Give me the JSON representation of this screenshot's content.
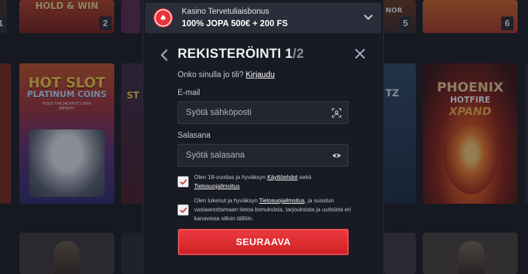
{
  "background_games": {
    "top_row": [
      {
        "name": "HOLD & WIN",
        "rank": "1"
      },
      {
        "name": "",
        "rank": "2"
      },
      {
        "name": "",
        "rank": ""
      },
      {
        "name": "NOR",
        "rank": "5"
      },
      {
        "name": "",
        "rank": "6"
      }
    ],
    "middle_row": [
      {
        "name": "HOT SLOT",
        "subtitle": "PLATINUM COINS",
        "tagline": "HOLD THE JACKPOT CASH INFINITY"
      },
      {
        "name": "ST"
      },
      {
        "name": "TZ"
      },
      {
        "name": "PHOENIX",
        "subtitle": "HOTFIRE",
        "tagline": "XPAND"
      }
    ]
  },
  "bonus_banner": {
    "chip_symbol": "♠",
    "title": "Kasino Tervetuliaisbonus",
    "offer": "100% JOPA 500€ + 200 FS",
    "expand_icon": "chevron-down-icon"
  },
  "form": {
    "back_icon": "chevron-left-icon",
    "title": "REKISTERÖINTI",
    "step": "1",
    "total": "/2",
    "close_icon": "close-icon",
    "login_question": "Onko sinulla jo tili?",
    "login_link": "Kirjaudu",
    "email": {
      "label": "E-mail",
      "placeholder": "Syötä sähköposti",
      "icon": "scan-icon"
    },
    "password": {
      "label": "Salasana",
      "placeholder": "Syötä salasana",
      "icon": "eye-icon"
    },
    "terms": {
      "checked": true,
      "text_before": "Olen 18-vuotias ja hyväksyn ",
      "link1": "Käyttöehdot",
      "text_mid": " sekä ",
      "link2": "Tietosuojailmoitus"
    },
    "marketing": {
      "checked": true,
      "text_before": "Olen lukenut ja hyväksyn ",
      "link": "Tietosuojailmoitus",
      "text_after": ", ja suostun vastaanottamaan tietoa bonuksista, tarjouksista ja uutisista eri kanavissa silloin tällöin."
    },
    "submit_label": "SEURAAVA"
  },
  "colors": {
    "accent_red": "#e8343a",
    "modal_bg": "#191b24",
    "banner_bg": "#2b2e3a"
  }
}
